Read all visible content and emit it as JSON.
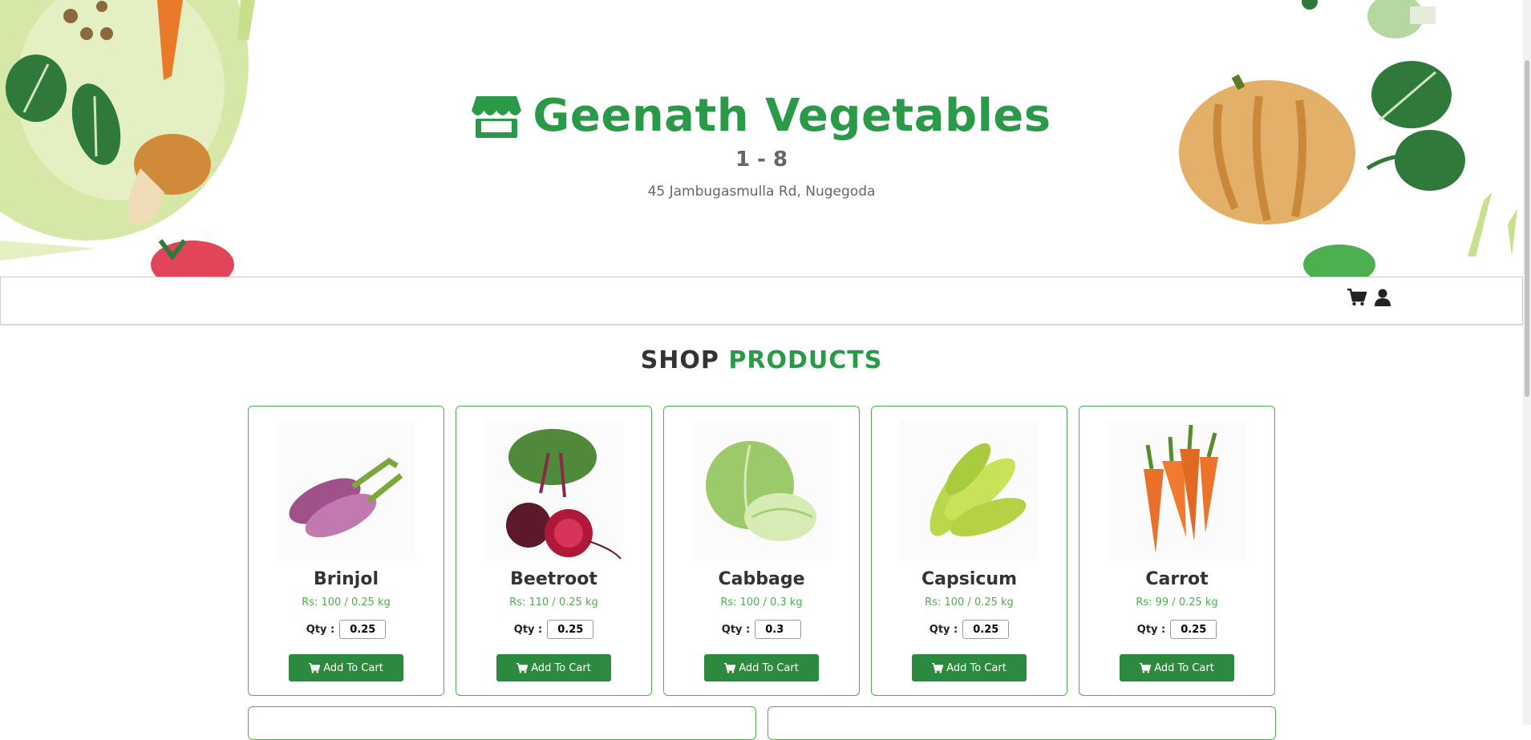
{
  "store": {
    "name": "Geenath Vegetables",
    "hours": "1 - 8",
    "address": "45 Jambugasmulla Rd, Nugegoda",
    "icon": "store-icon"
  },
  "nav": {
    "cart_icon": "cart-icon",
    "user_icon": "user-icon"
  },
  "section": {
    "title_part1": "SHOP",
    "title_part2": "PRODUCTS"
  },
  "products": [
    {
      "name": "Brinjol",
      "price": "Rs: 100 / 0.25 kg",
      "qty_label": "Qty :",
      "qty": "0.25",
      "button": "Add To Cart",
      "image": "brinjal"
    },
    {
      "name": "Beetroot",
      "price": "Rs: 110 / 0.25 kg",
      "qty_label": "Qty :",
      "qty": "0.25",
      "button": "Add To Cart",
      "image": "beetroot"
    },
    {
      "name": "Cabbage",
      "price": "Rs: 100 / 0.3 kg",
      "qty_label": "Qty :",
      "qty": "0.3",
      "button": "Add To Cart",
      "image": "cabbage"
    },
    {
      "name": "Capsicum",
      "price": "Rs: 100 / 0.25 kg",
      "qty_label": "Qty :",
      "qty": "0.25",
      "button": "Add To Cart",
      "image": "capsicum"
    },
    {
      "name": "Carrot",
      "price": "Rs: 99 / 0.25 kg",
      "qty_label": "Qty :",
      "qty": "0.25",
      "button": "Add To Cart",
      "image": "carrot"
    }
  ],
  "colors": {
    "brand": "#2b9a48",
    "button": "#2b8a3e",
    "card_border": "#4caf50"
  }
}
